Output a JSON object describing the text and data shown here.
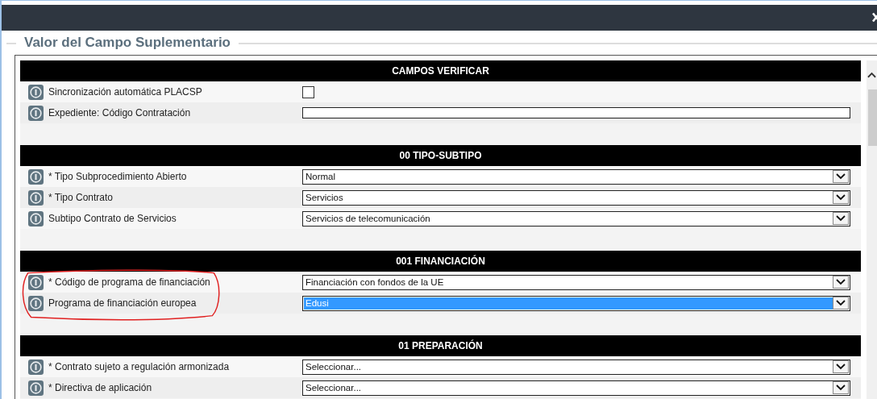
{
  "dialog": {
    "title": "Valor del Campo Suplementario"
  },
  "sections": [
    {
      "title": "CAMPOS VERIFICAR",
      "fields": [
        {
          "kind": "checkbox",
          "label": "Sincronización automática PLACSP",
          "checked": false
        },
        {
          "kind": "text",
          "label": "Expediente: Código Contratación"
        }
      ]
    },
    {
      "title": "00 TIPO-SUBTIPO",
      "fields": [
        {
          "kind": "select",
          "label": "* Tipo Subprocedimiento Abierto",
          "value": "Normal",
          "highlighted": false
        },
        {
          "kind": "select",
          "label": "* Tipo Contrato",
          "value": "Servicios",
          "highlighted": false
        },
        {
          "kind": "select",
          "label": "Subtipo Contrato de Servicios",
          "value": "Servicios de telecomunicación",
          "highlighted": false
        }
      ]
    },
    {
      "title": "001 FINANCIACIÓN",
      "annotated": true,
      "fields": [
        {
          "kind": "select",
          "label": "* Código de programa de financiación",
          "value": "Financiación con fondos de la UE",
          "highlighted": false
        },
        {
          "kind": "select",
          "label": "Programa de financiación europea",
          "value": "Edusi",
          "highlighted": true
        }
      ]
    },
    {
      "title": "01 PREPARACIÓN",
      "fields": [
        {
          "kind": "select",
          "label": "* Contrato sujeto a regulación armonizada",
          "value": "Seleccionar...",
          "highlighted": false
        },
        {
          "kind": "select",
          "label": "* Directiva de aplicación",
          "value": "Seleccionar...",
          "highlighted": false
        }
      ]
    }
  ]
}
